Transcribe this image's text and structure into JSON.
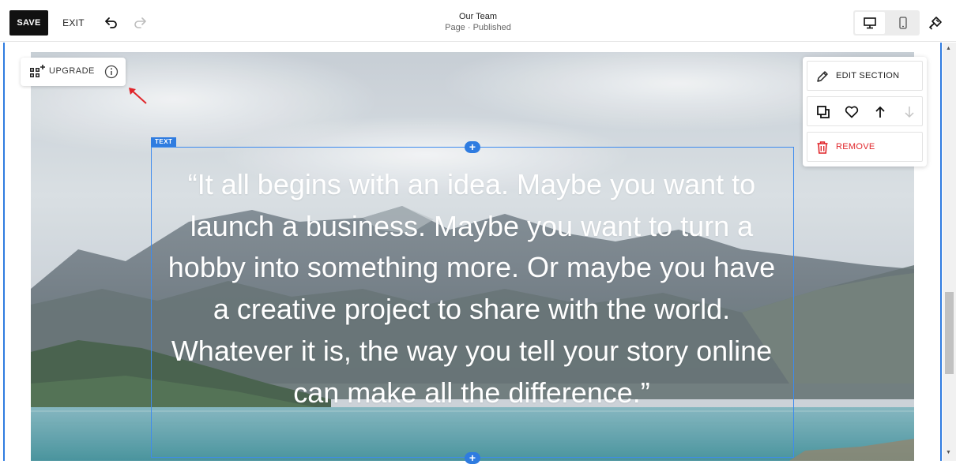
{
  "toolbar": {
    "save_label": "SAVE",
    "exit_label": "EXIT",
    "undo_icon": "undo-icon",
    "redo_icon": "redo-icon",
    "design_icon": "paintbrush-icon"
  },
  "page": {
    "title": "Our Team",
    "status": "Page · Published"
  },
  "view_toggle": {
    "options": [
      "desktop-icon",
      "mobile-icon"
    ],
    "selected": "desktop"
  },
  "upgrade": {
    "label": "UPGRADE",
    "icon": "apps-plus-icon",
    "info_icon": "info-icon"
  },
  "text_block": {
    "tag": "TEXT",
    "quote": "“It all begins with an idea. Maybe you want to launch a business. Maybe you want to turn a hobby into something more. Or maybe you have a creative project to share with the world. Whatever it is, the way you tell your story online can make all the difference.”"
  },
  "section_panel": {
    "edit_label": "EDIT SECTION",
    "remove_label": "REMOVE",
    "tools": [
      "duplicate-icon",
      "heart-icon",
      "arrow-up-icon",
      "arrow-down-icon"
    ]
  },
  "colors": {
    "accent": "#2f7ce0",
    "remove": "#e0252a",
    "annotation_arrow": "#e0252a"
  }
}
